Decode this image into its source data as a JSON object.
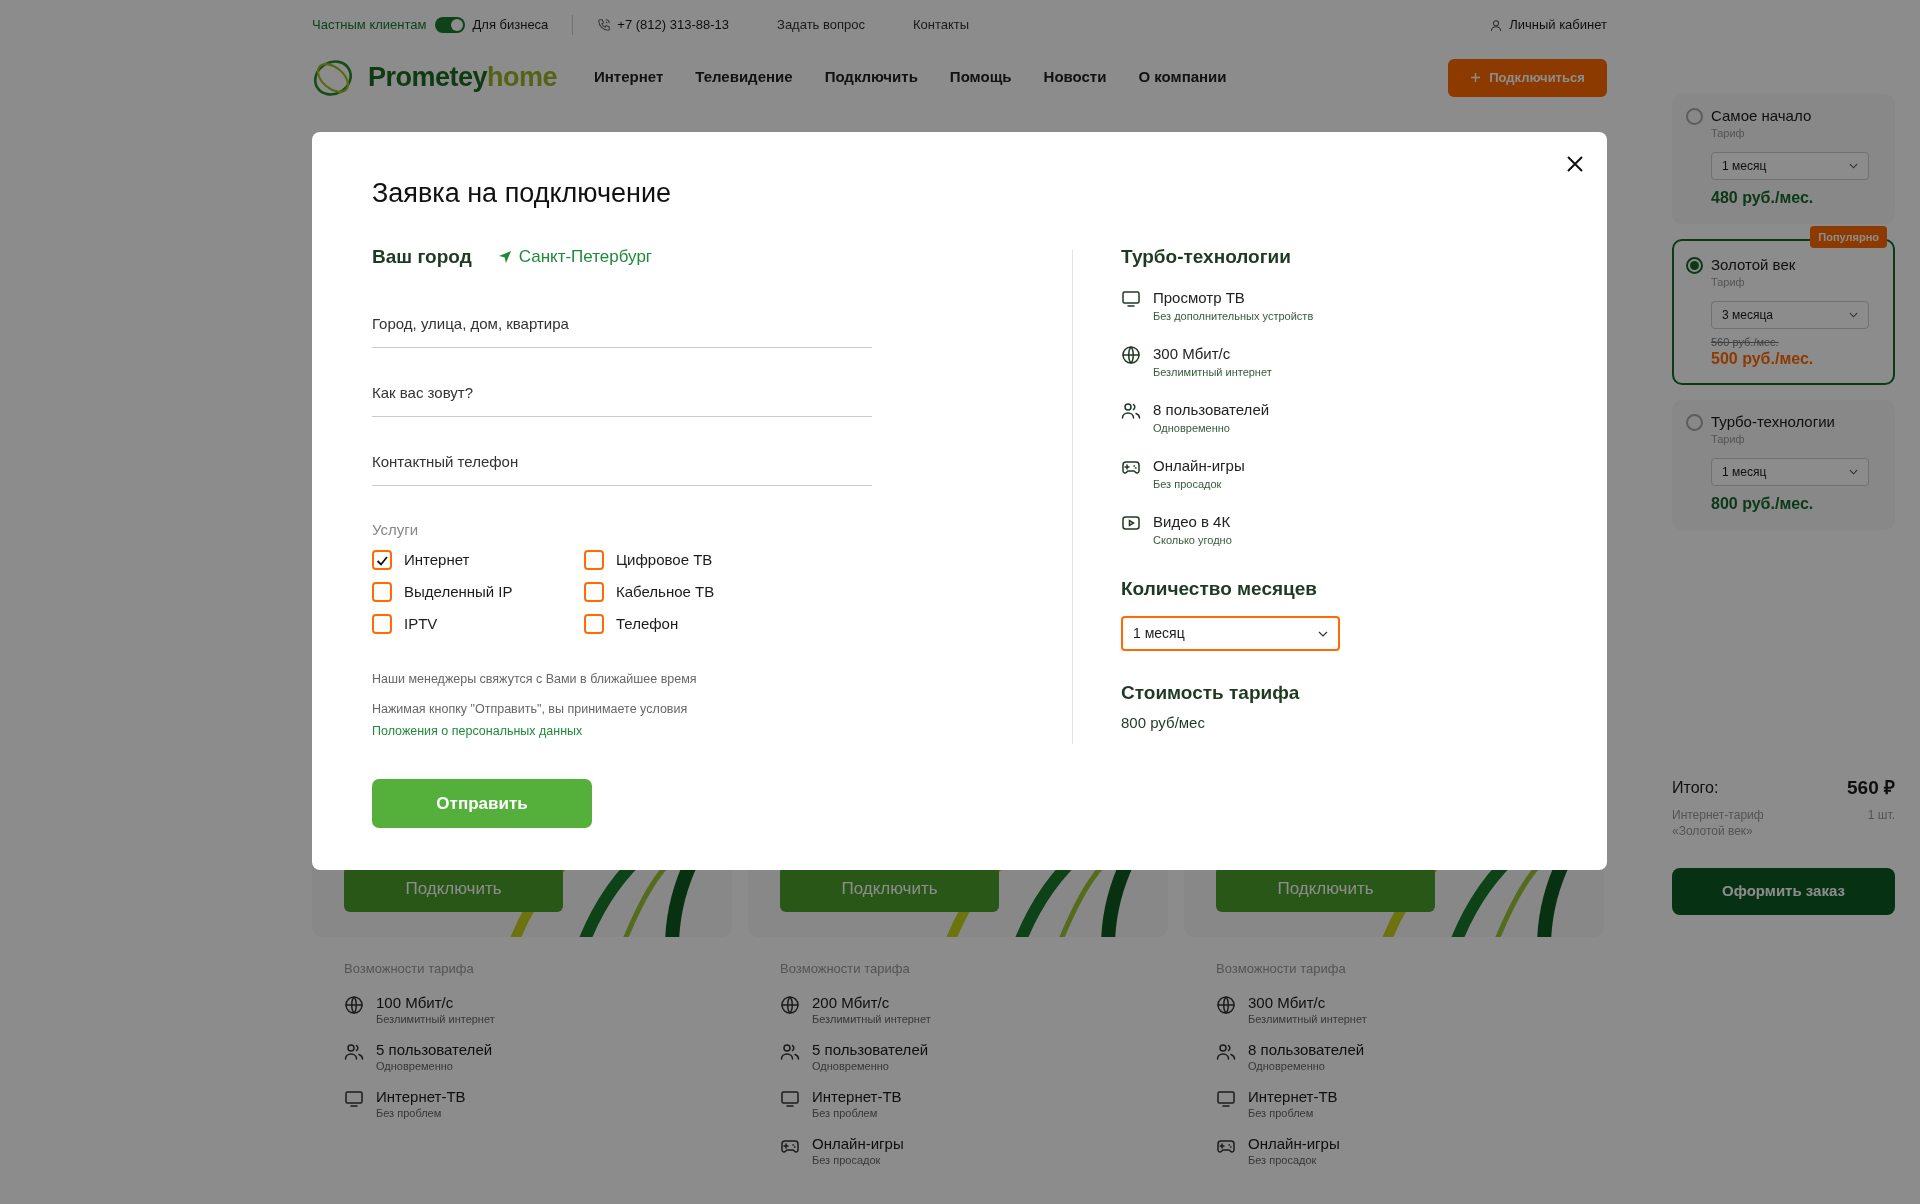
{
  "top_bar": {
    "toggle_on": true,
    "client_types": [
      {
        "label": "Частным клиентам",
        "selected": true
      },
      {
        "label": "Для бизнеса",
        "selected": false
      }
    ],
    "phone": "+7 (812) 313-88-13",
    "links": [
      "Задать вопрос",
      "Контакты"
    ],
    "account": "Личный кабинет"
  },
  "nav": {
    "logo": {
      "part1": "Prometey",
      "part2": "home"
    },
    "items": [
      "Интернет",
      "Телевидение",
      "Подключить",
      "Помощь",
      "Новости",
      "О компании"
    ],
    "cta": "Подключиться"
  },
  "tariff_cards": [
    {
      "button": "Подключить",
      "features_title": "Возможности тарифа",
      "features": [
        {
          "kind": "globe",
          "title": "100 Мбит/с",
          "subtitle": "Безлимитный интернет"
        },
        {
          "kind": "users",
          "title": "5 пользователей",
          "subtitle": "Одновременно"
        },
        {
          "kind": "tv",
          "title": "Интернет-ТВ",
          "subtitle": "Без проблем"
        }
      ]
    },
    {
      "button": "Подключить",
      "features_title": "Возможности тарифа",
      "features": [
        {
          "kind": "globe",
          "title": "200 Мбит/с",
          "subtitle": "Безлимитный интернет"
        },
        {
          "kind": "users",
          "title": "5 пользователей",
          "subtitle": "Одновременно"
        },
        {
          "kind": "tv",
          "title": "Интернет-ТВ",
          "subtitle": "Без проблем"
        },
        {
          "kind": "gamepad",
          "title": "Онлайн-игры",
          "subtitle": "Без просадок"
        }
      ]
    },
    {
      "button": "Подключить",
      "features_title": "Возможности тарифа",
      "features": [
        {
          "kind": "globe",
          "title": "300 Мбит/с",
          "subtitle": "Безлимитный интернет"
        },
        {
          "kind": "users",
          "title": "8 пользователей",
          "subtitle": "Одновременно"
        },
        {
          "kind": "tv",
          "title": "Интернет-ТВ",
          "subtitle": "Без проблем"
        },
        {
          "kind": "gamepad",
          "title": "Онлайн-игры",
          "subtitle": "Без просадок"
        }
      ]
    }
  ],
  "sidebar": {
    "tariffs": [
      {
        "name": "Самое начало",
        "type": "Тариф",
        "period": "1 месяц",
        "price": "480 руб./мес.",
        "selected": false
      },
      {
        "name": "Золотой век",
        "type": "Тариф",
        "period": "3 месяца",
        "old_price": "560 руб./мес.",
        "price": "500 руб./мес.",
        "badge": "Популярно",
        "selected": true
      },
      {
        "name": "Турбо-технологии",
        "type": "Тариф",
        "period": "1 месяц",
        "price": "800 руб./мес.",
        "selected": false
      }
    ],
    "total_label": "Итого:",
    "total": "560 ₽",
    "item": "Интернет-тариф «Золотой век»",
    "quantity": "1 шт.",
    "order_button": "Оформить заказ"
  },
  "modal": {
    "title": "Заявка на подключение",
    "city_label": "Ваш город",
    "city": "Санкт-Петербург",
    "fields": [
      {
        "placeholder": "Город, улица, дом, квартира"
      },
      {
        "placeholder": "Как вас зовут?"
      },
      {
        "placeholder": "Контактный телефон"
      }
    ],
    "services_label": "Услуги",
    "services": [
      {
        "label": "Интернет",
        "checked": true
      },
      {
        "label": "Цифровое ТВ",
        "checked": false
      },
      {
        "label": "Выделенный IP",
        "checked": false
      },
      {
        "label": "Кабельное ТВ",
        "checked": false
      },
      {
        "label": "IPTV",
        "checked": false
      },
      {
        "label": "Телефон",
        "checked": false
      }
    ],
    "note": "Наши менеджеры свяжутся с Вами в ближайшее время",
    "consent": "Нажимая кнопку \"Отправить\", вы принимаете условия",
    "consent_link": "Положения о персональных данных",
    "submit": "Отправить",
    "features_title": "Турбо-технологии",
    "features": [
      {
        "kind": "tv",
        "title": "Просмотр ТВ",
        "subtitle": "Без дополнительных устройств"
      },
      {
        "kind": "globe",
        "title": "300 Мбит/с",
        "subtitle": "Безлимитный интернет"
      },
      {
        "kind": "users",
        "title": "8 пользователей",
        "subtitle": "Одновременно"
      },
      {
        "kind": "gamepad",
        "title": "Онлайн-игры",
        "subtitle": "Без просадок"
      },
      {
        "kind": "play",
        "title": "Видео в 4К",
        "subtitle": "Сколько угодно"
      }
    ],
    "months_label": "Количество месяцев",
    "months_value": "1 месяц",
    "cost_label": "Стоимость тарифа",
    "cost": "800 руб/мес"
  }
}
